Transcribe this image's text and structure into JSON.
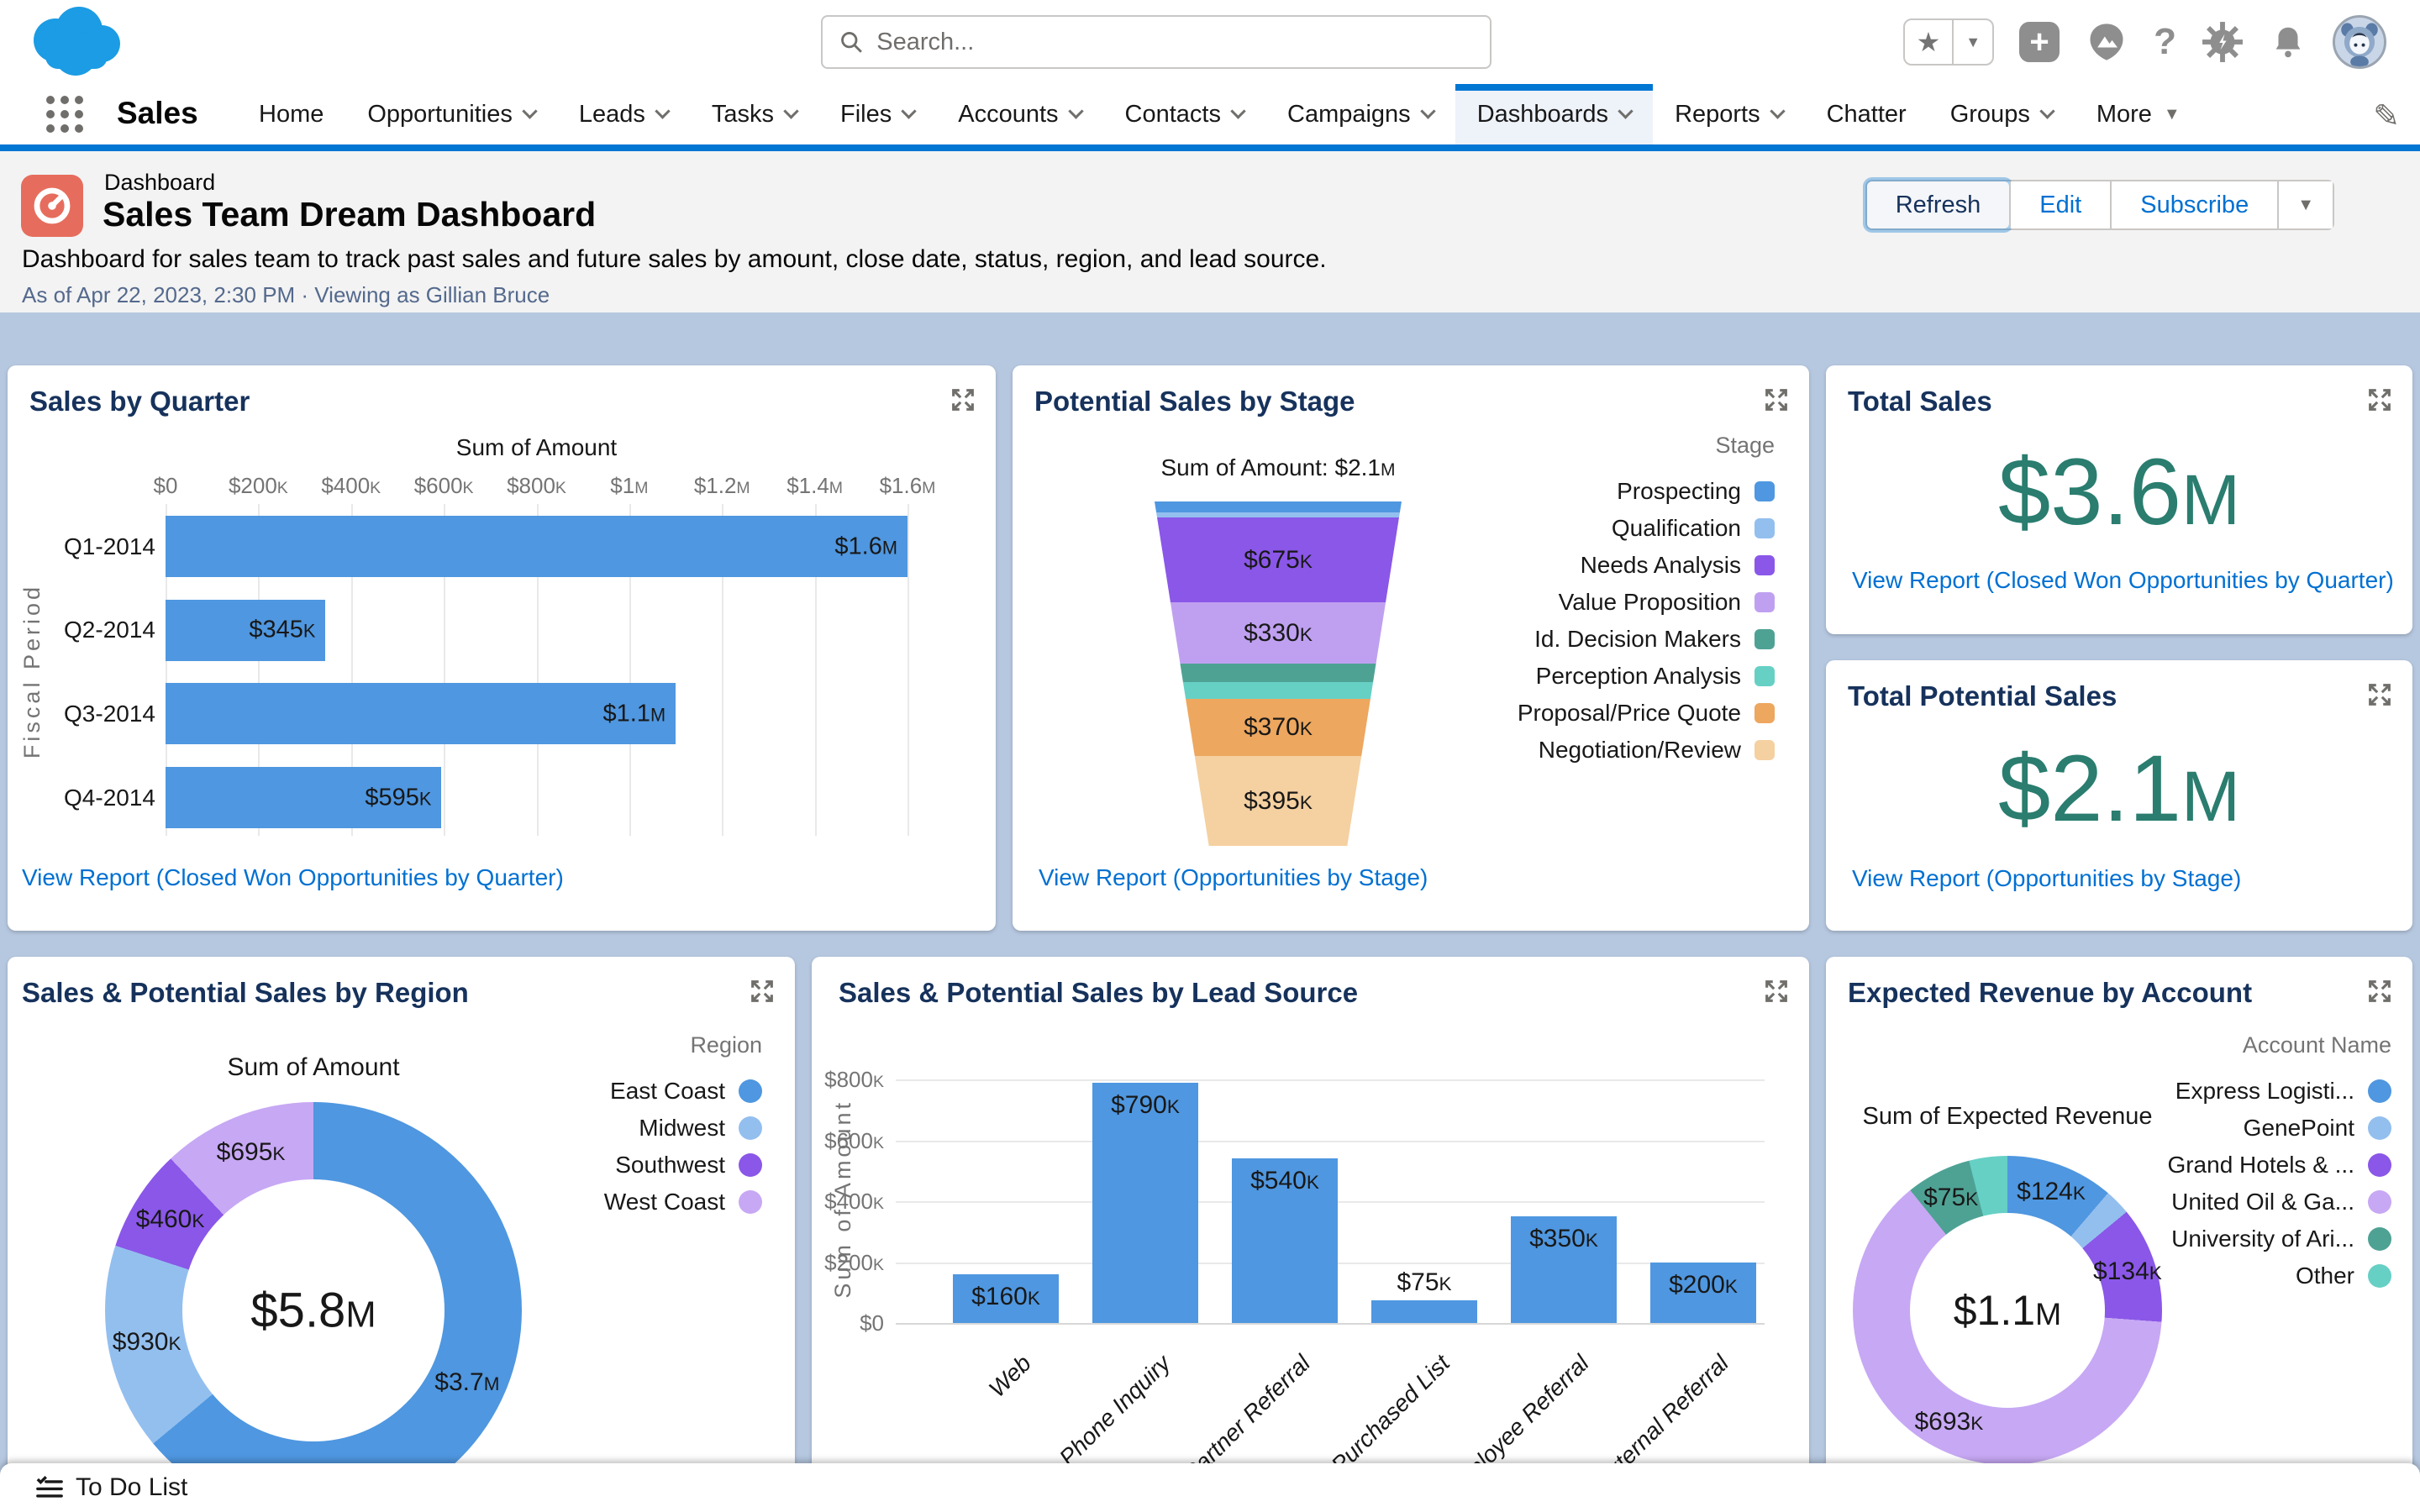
{
  "icons": {
    "star": "★",
    "caret": "▼",
    "plus": "+",
    "help": "?",
    "pencil": "✎"
  },
  "search": {
    "placeholder": "Search..."
  },
  "nav": {
    "app_name": "Sales",
    "tabs": [
      {
        "label": "Home",
        "chevron": false,
        "active": false
      },
      {
        "label": "Opportunities",
        "chevron": true,
        "active": false
      },
      {
        "label": "Leads",
        "chevron": true,
        "active": false
      },
      {
        "label": "Tasks",
        "chevron": true,
        "active": false
      },
      {
        "label": "Files",
        "chevron": true,
        "active": false
      },
      {
        "label": "Accounts",
        "chevron": true,
        "active": false
      },
      {
        "label": "Contacts",
        "chevron": true,
        "active": false
      },
      {
        "label": "Campaigns",
        "chevron": true,
        "active": false
      },
      {
        "label": "Dashboards",
        "chevron": true,
        "active": true
      },
      {
        "label": "Reports",
        "chevron": true,
        "active": false
      },
      {
        "label": "Chatter",
        "chevron": false,
        "active": false
      },
      {
        "label": "Groups",
        "chevron": true,
        "active": false
      },
      {
        "label": "More",
        "chevron": false,
        "caret": true,
        "active": false
      }
    ]
  },
  "page_header": {
    "eyebrow": "Dashboard",
    "title": "Sales Team Dream Dashboard",
    "description": "Dashboard for sales team to track past sales and future sales by amount, close date, status, region, and lead source.",
    "as_of": "As of Apr 22, 2023, 2:30 PM · Viewing as Gillian Bruce",
    "buttons": {
      "refresh": "Refresh",
      "edit": "Edit",
      "subscribe": "Subscribe"
    }
  },
  "colors": {
    "accent": "#0176D3",
    "link": "#0070D2",
    "metric_teal": "#2A7D6F",
    "bar_blue": "#4F97E0",
    "canvas": "#B6C8E0",
    "title_navy": "#16325C"
  },
  "cards": {
    "quarter": {
      "title": "Sales by Quarter",
      "link": "View Report (Closed Won Opportunities by Quarter)",
      "chart_data": {
        "type": "bar",
        "orientation": "horizontal",
        "axis_title": "Sum of Amount",
        "ylabel": "Fiscal Period",
        "categories": [
          "Q1-2014",
          "Q2-2014",
          "Q3-2014",
          "Q4-2014"
        ],
        "values_k": [
          1600,
          345,
          1100,
          595
        ],
        "labels": [
          "$1.6M",
          "$345K",
          "$1.1M",
          "$595K"
        ],
        "x_ticks": [
          "$0",
          "$200K",
          "$400K",
          "$600K",
          "$800K",
          "$1M",
          "$1.2M",
          "$1.4M",
          "$1.6M"
        ],
        "xlim_k": [
          0,
          1600
        ],
        "grid": true
      }
    },
    "stage": {
      "title": "Potential Sales by Stage",
      "link": "View Report (Opportunities by Stage)",
      "chart_data": {
        "type": "funnel",
        "total_label": "Sum of Amount: $2.1M",
        "legend_title": "Stage",
        "legend_position": "right",
        "segments": [
          {
            "name": "Prospecting",
            "color": "#4F97E0",
            "value_k": 80,
            "label": "",
            "height_frac": 0.032
          },
          {
            "name": "Qualification",
            "color": "#93BFEF",
            "value_k": 30,
            "label": "",
            "height_frac": 0.015
          },
          {
            "name": "Needs Analysis",
            "color": "#8A57E8",
            "value_k": 675,
            "label": "$675K",
            "height_frac": 0.246
          },
          {
            "name": "Value Proposition",
            "color": "#BFA0F0",
            "value_k": 330,
            "label": "$330K",
            "height_frac": 0.178
          },
          {
            "name": "Id. Decision Makers",
            "color": "#4EA294",
            "value_k": 110,
            "label": "",
            "height_frac": 0.054
          },
          {
            "name": "Perception Analysis",
            "color": "#66D0C5",
            "value_k": 100,
            "label": "",
            "height_frac": 0.049
          },
          {
            "name": "Proposal/Price Quote",
            "color": "#EDA75F",
            "value_k": 370,
            "label": "$370K",
            "height_frac": 0.166
          },
          {
            "name": "Negotiation/Review",
            "color": "#F5D0A1",
            "value_k": 395,
            "label": "$395K",
            "height_frac": 0.26
          }
        ]
      }
    },
    "total_sales": {
      "title": "Total Sales",
      "value": "$3.6M",
      "link": "View Report (Closed Won Opportunities by Quarter)"
    },
    "total_potential": {
      "title": "Total Potential Sales",
      "value": "$2.1M",
      "link": "View Report (Opportunities by Stage)"
    },
    "region": {
      "title": "Sales & Potential Sales by Region",
      "chart_data": {
        "type": "pie",
        "subtitle": "Sum of Amount",
        "center_label": "$5.8M",
        "legend_title": "Region",
        "legend_position": "right",
        "slices": [
          {
            "name": "East Coast",
            "color": "#4F97E0",
            "value_k": 3700,
            "label": "$3.7M"
          },
          {
            "name": "Midwest",
            "color": "#93BFEF",
            "value_k": 930,
            "label": "$930K"
          },
          {
            "name": "Southwest",
            "color": "#8A57E8",
            "value_k": 460,
            "label": "$460K"
          },
          {
            "name": "West Coast",
            "color": "#C7A8F4",
            "value_k": 695,
            "label": "$695K"
          }
        ]
      }
    },
    "lead_source": {
      "title": "Sales & Potential Sales by Lead Source",
      "chart_data": {
        "type": "bar",
        "orientation": "vertical",
        "ylabel": "Sum of Amount",
        "categories": [
          "Web",
          "Phone Inquiry",
          "Partner Referral",
          "Purchased List",
          "Employee Referral",
          "External Referral"
        ],
        "values_k": [
          160,
          790,
          540,
          75,
          350,
          200
        ],
        "labels": [
          "$160K",
          "$790K",
          "$540K",
          "$75K",
          "$350K",
          "$200K"
        ],
        "y_ticks": [
          "$0",
          "$200K",
          "$400K",
          "$600K",
          "$800K"
        ],
        "ylim_k": [
          0,
          800
        ],
        "grid": true
      }
    },
    "expected": {
      "title": "Expected Revenue by Account",
      "chart_data": {
        "type": "pie",
        "subtitle": "Sum of Expected Revenue",
        "center_label": "$1.1M",
        "legend_title": "Account Name",
        "legend_position": "right",
        "slices": [
          {
            "name": "Express Logisti...",
            "color": "#4F97E0",
            "value_k": 124,
            "label": "$124K"
          },
          {
            "name": "GenePoint",
            "color": "#93BFEF",
            "value_k": 30,
            "label": ""
          },
          {
            "name": "Grand Hotels & ...",
            "color": "#8A57E8",
            "value_k": 134,
            "label": "$134K"
          },
          {
            "name": "United Oil & Ga...",
            "color": "#C7A8F4",
            "value_k": 693,
            "label": "$693K"
          },
          {
            "name": "University of Ari...",
            "color": "#4EA294",
            "value_k": 75,
            "label": "$75K"
          },
          {
            "name": "Other",
            "color": "#66D0C5",
            "value_k": 44,
            "label": ""
          }
        ]
      }
    }
  },
  "dock": {
    "label": "To Do List"
  }
}
